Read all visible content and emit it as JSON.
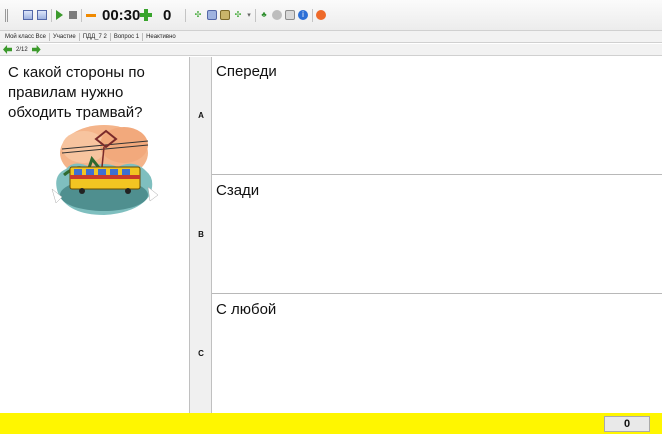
{
  "toolbar": {
    "timer": "00:30",
    "score": "0",
    "colors": {
      "accent_green": "#38a42c",
      "accent_orange": "#f08a00",
      "status_yellow": "#fff600"
    },
    "icons": [
      "grip-handle",
      "window-icon",
      "layout-icon",
      "play-icon",
      "stop-icon",
      "minus-icon",
      "plus-icon",
      "tool-icons"
    ]
  },
  "infobar": {
    "items": [
      "Мой класс  Все",
      "Участие",
      "ПДД_7   2",
      "Вопрос 1",
      "Неактивно"
    ]
  },
  "nav": {
    "page": "2/12"
  },
  "question": {
    "text": "С какой стороны по правилам нужно обходить трамвай?",
    "image": "tram-illustration"
  },
  "answers": [
    {
      "letter": "A",
      "text": "Спереди"
    },
    {
      "letter": "B",
      "text": "Сзади"
    },
    {
      "letter": "C",
      "text": "С любой"
    }
  ],
  "status": {
    "counter": "0"
  }
}
